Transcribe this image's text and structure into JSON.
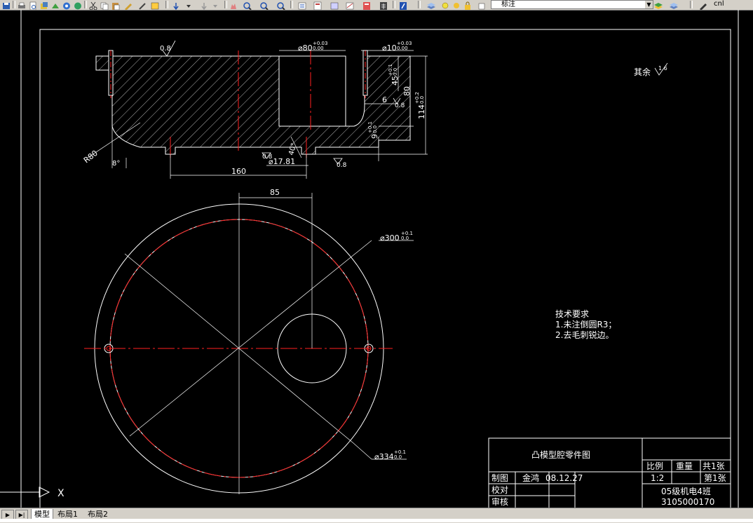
{
  "app": {
    "layer_combo_value": "标注",
    "right_combo_value": "cnl"
  },
  "toolbar_icons": [
    "save-icon",
    "print-icon",
    "preview-icon",
    "publish-icon",
    "cut-icon",
    "copy-icon",
    "paste-icon",
    "match-icon",
    "undo-icon",
    "redo-icon",
    "pan-icon",
    "zoom-realtime-icon",
    "zoom-window-icon",
    "zoom-previous-icon",
    "properties-icon",
    "design-center-icon",
    "tool-palette-icon",
    "sheet-set-icon",
    "markup-icon",
    "calc-icon",
    "help-icon",
    "layer-manager-icon",
    "layer-state-icon",
    "layer-previous-icon"
  ],
  "drawing": {
    "section_view": {
      "dims": {
        "d80": "⌀80",
        "d80_tol_up": "+0.03",
        "d80_tol_low": "0.00",
        "d10": "⌀10",
        "d10_tol_up": "+0.03",
        "d10_tol_low": "0.00",
        "h45": "45",
        "h45_tol_up": "+0.1",
        "h45_tol_low": "0.0",
        "h80": "80",
        "h114": "114",
        "h114_tol_up": "+0.2",
        "h114_tol_low": "0.0",
        "h9": "9",
        "h9_tol_up": "+0.1",
        "h9_tol_low": "0.0",
        "w6": "6",
        "r80": "R80",
        "ang8": "8°",
        "w160": "160",
        "d17": "⌀17.81",
        "ang40": "40°",
        "rough_top": "0.8",
        "rough_mid": "0.8",
        "rough_right": "0.8",
        "rough_bottom": "0.8",
        "rough_small": "0.8"
      }
    },
    "plan_view": {
      "dims": {
        "w85": "85",
        "d300": "⌀300",
        "d300_tol_up": "+0.1",
        "d300_tol_low": "0.0",
        "d334": "⌀334",
        "d334_tol_up": "+0.1",
        "d334_tol_low": "0.0"
      }
    },
    "other_roughness": {
      "label": "其余",
      "value": "1.6"
    },
    "tech_requirements": {
      "title": "技术要求",
      "line1": "1.未注倒圆R3；",
      "line2": "2.去毛刺锐边。"
    },
    "title_block": {
      "drawing_title": "凸模型腔零件图",
      "scale_label": "比例",
      "weight_label": "重量",
      "sheets_total": "共1张",
      "scale_value": "1:2",
      "sheet_num": "第1张",
      "drawn_label": "制图",
      "drawn_by": "金鸿",
      "drawn_date": "08.12.27",
      "checked_label": "校对",
      "approved_label": "审核",
      "class_name": "05级机电4班",
      "student_id": "3105000170"
    },
    "ucs_x_label": "X"
  },
  "tabs": {
    "model": "模型",
    "layout1": "布局1",
    "layout2": "布局2"
  }
}
